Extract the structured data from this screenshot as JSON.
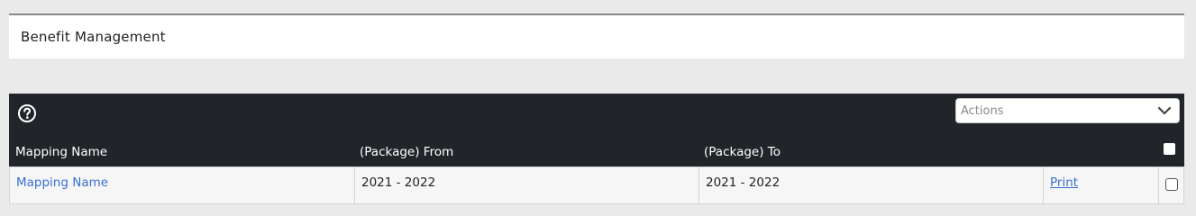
{
  "header": {
    "title": "Benefit Management"
  },
  "toolbar": {
    "help_icon": "help-circle-icon",
    "actions": {
      "selected": "Actions",
      "chevron_icon": "chevron-down-icon"
    }
  },
  "table": {
    "columns": [
      "Mapping Name",
      "(Package) From",
      "(Package) To",
      "",
      ""
    ],
    "rows": [
      {
        "mapping_name": "Mapping Name",
        "from": "2021 - 2022",
        "to": "2021 - 2022",
        "print": "Print",
        "checked": false
      }
    ]
  },
  "colors": {
    "toolbar_bg": "#212429",
    "link": "#3a6fd1",
    "page_bg": "#eaeaea"
  }
}
